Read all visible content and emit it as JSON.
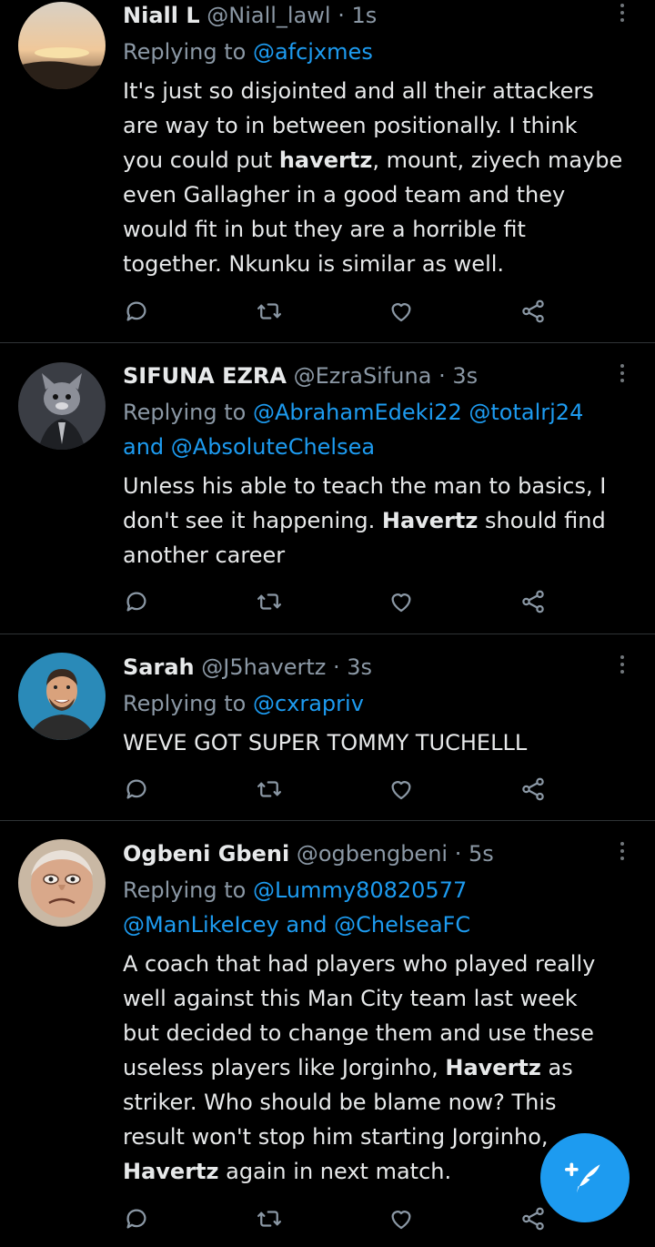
{
  "tweets": [
    {
      "name": "Niall L",
      "handle": "@Niall_lawl",
      "dot": "·",
      "time": "1s",
      "replying_prefix": "Replying to",
      "mention1": "@afcjxmes",
      "lines": [
        [
          "It's just so disjointed and all their attackers",
          "",
          ""
        ],
        [
          "are way to in between positionally. I think",
          "",
          ""
        ],
        [
          "you could put ",
          "havertz",
          ", mount, ziyech maybe"
        ],
        [
          "even Gallagher in a good team and they",
          "",
          ""
        ],
        [
          "would fit in but they are a horrible fit",
          "",
          ""
        ],
        [
          "together. Nkunku is similar as well.",
          "",
          ""
        ]
      ]
    },
    {
      "name": "SIFUNA EZRA",
      "handle": "@EzraSifuna",
      "dot": "·",
      "time": "3s",
      "replying_prefix": "Replying to",
      "mention1": "@AbrahamEdeki22",
      "mention2": "@totalrj24",
      "and": "and",
      "mention3": "@AbsoluteChelsea",
      "lines": [
        [
          "Unless his able to teach the man to basics, I",
          "",
          ""
        ],
        [
          "don't see it happening. ",
          "Havertz",
          " should find"
        ],
        [
          "another career",
          "",
          ""
        ]
      ]
    },
    {
      "name": "Sarah",
      "handle": "@J5havertz",
      "dot": "·",
      "time": "3s",
      "replying_prefix": "Replying to",
      "mention1": "@cxrapriv",
      "lines": [
        [
          "WEVE GOT SUPER TOMMY TUCHELLL",
          "",
          ""
        ]
      ]
    },
    {
      "name": "Ogbeni Gbeni",
      "handle": "@ogbengbeni",
      "dot": "·",
      "time": "5s",
      "replying_prefix": "Replying to",
      "mention1": "@Lummy80820577",
      "mention2": "@ManLikeIcey",
      "and": "and",
      "mention3": "@ChelseaFC",
      "lines": [
        [
          "A coach that had players who played really",
          "",
          ""
        ],
        [
          "well against this Man City team last week",
          "",
          ""
        ],
        [
          "but decided to change them and use these",
          "",
          ""
        ],
        [
          "useless players like Jorginho, ",
          "Havertz",
          " as"
        ],
        [
          "striker. Who should be blame now? This",
          "",
          ""
        ],
        [
          "result won't stop him starting Jorginho,",
          "",
          ""
        ],
        [
          "",
          "Havertz",
          " again in next match."
        ]
      ]
    }
  ],
  "icons": {
    "reply": "reply-icon",
    "retweet": "retweet-icon",
    "like": "heart-icon",
    "share": "share-icon",
    "more": "more-vertical-icon",
    "compose": "compose-tweet-icon"
  },
  "colors": {
    "background": "#000000",
    "text": "#e7e9ea",
    "secondary": "#8b98a5",
    "accent": "#1d9bf0",
    "divider": "#2f3336"
  }
}
